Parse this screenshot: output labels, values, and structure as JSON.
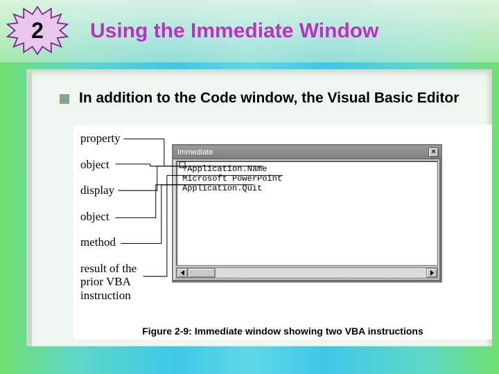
{
  "slide_number": "2",
  "title": "Using the Immediate Window",
  "bullet": "In addition to the Code window, the Visual Basic Editor",
  "labels": {
    "property": "property",
    "object1": "object",
    "display": "display",
    "object2": "object",
    "method": "method",
    "result": "result of the\nprior VBA\ninstruction"
  },
  "immediate": {
    "title": "Immediate",
    "close_glyph": "×",
    "lines": [
      "?Application.Name",
      "Microsoft PowerPoint",
      "Application.Quit"
    ]
  },
  "caption": "Figure 2-9: Immediate window showing two VBA instructions"
}
